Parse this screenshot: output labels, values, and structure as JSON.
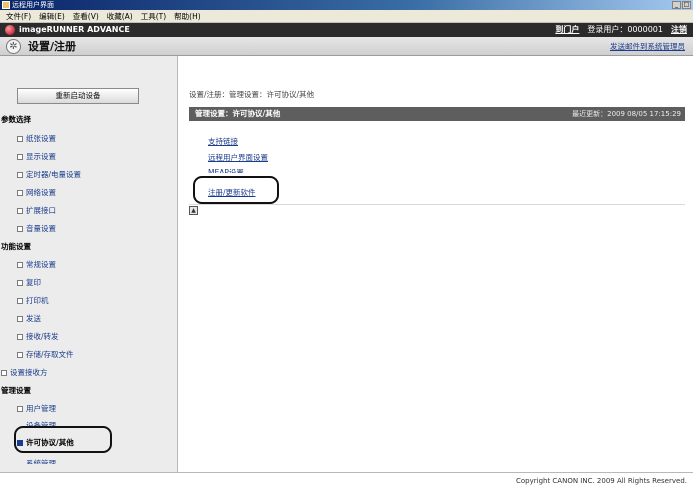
{
  "window": {
    "title": "远程用户界面",
    "controls": [
      "_",
      "□",
      "×"
    ]
  },
  "menubar": [
    "文件(F)",
    "编辑(E)",
    "查看(V)",
    "收藏(A)",
    "工具(T)",
    "帮助(H)"
  ],
  "header": {
    "brand": "imageRUNNER ADVANCE",
    "portal_link": "到门户",
    "login_label": "登录用户：0000001",
    "logout_link": "注销",
    "mode_title": "设置/注册",
    "send_mail_link": "发送邮件到系统管理员"
  },
  "sidebar": {
    "restart_button": "重新启动设备",
    "groups": [
      {
        "label": "参数选择",
        "items": [
          "纸张设置",
          "显示设置",
          "定时器/电量设置",
          "网络设置",
          "扩展接口",
          "音量设置"
        ]
      },
      {
        "label": "功能设置",
        "items": [
          "常规设置",
          "复印",
          "打印机",
          "发送",
          "接收/转发",
          "存储/存取文件"
        ]
      },
      {
        "label": "设置接收方",
        "items": []
      },
      {
        "label": "管理设置",
        "items": [
          "用户管理",
          "设备管理",
          "许可协议/其他",
          "系统管理"
        ]
      }
    ],
    "active_item": "许可协议/其他"
  },
  "main": {
    "breadcrumb": "设置/注册：管理设置：许可协议/其他",
    "panel_title": "管理设置：许可协议/其他",
    "last_updated": "最近更新：2009 08/05 17:15:29",
    "links": [
      "支持链接",
      "远程用户界面设置",
      "MEAP设置",
      "注册/更新软件"
    ],
    "highlighted_link": "注册/更新软件"
  },
  "footer": {
    "copyright": "Copyright CANON INC. 2009 All Rights Reserved."
  },
  "colors": {
    "link": "#1a3c8c",
    "brand_bar": "#2b2b2b",
    "panel_header": "#5e5e5e",
    "sidebar_bg": "#ececec"
  }
}
